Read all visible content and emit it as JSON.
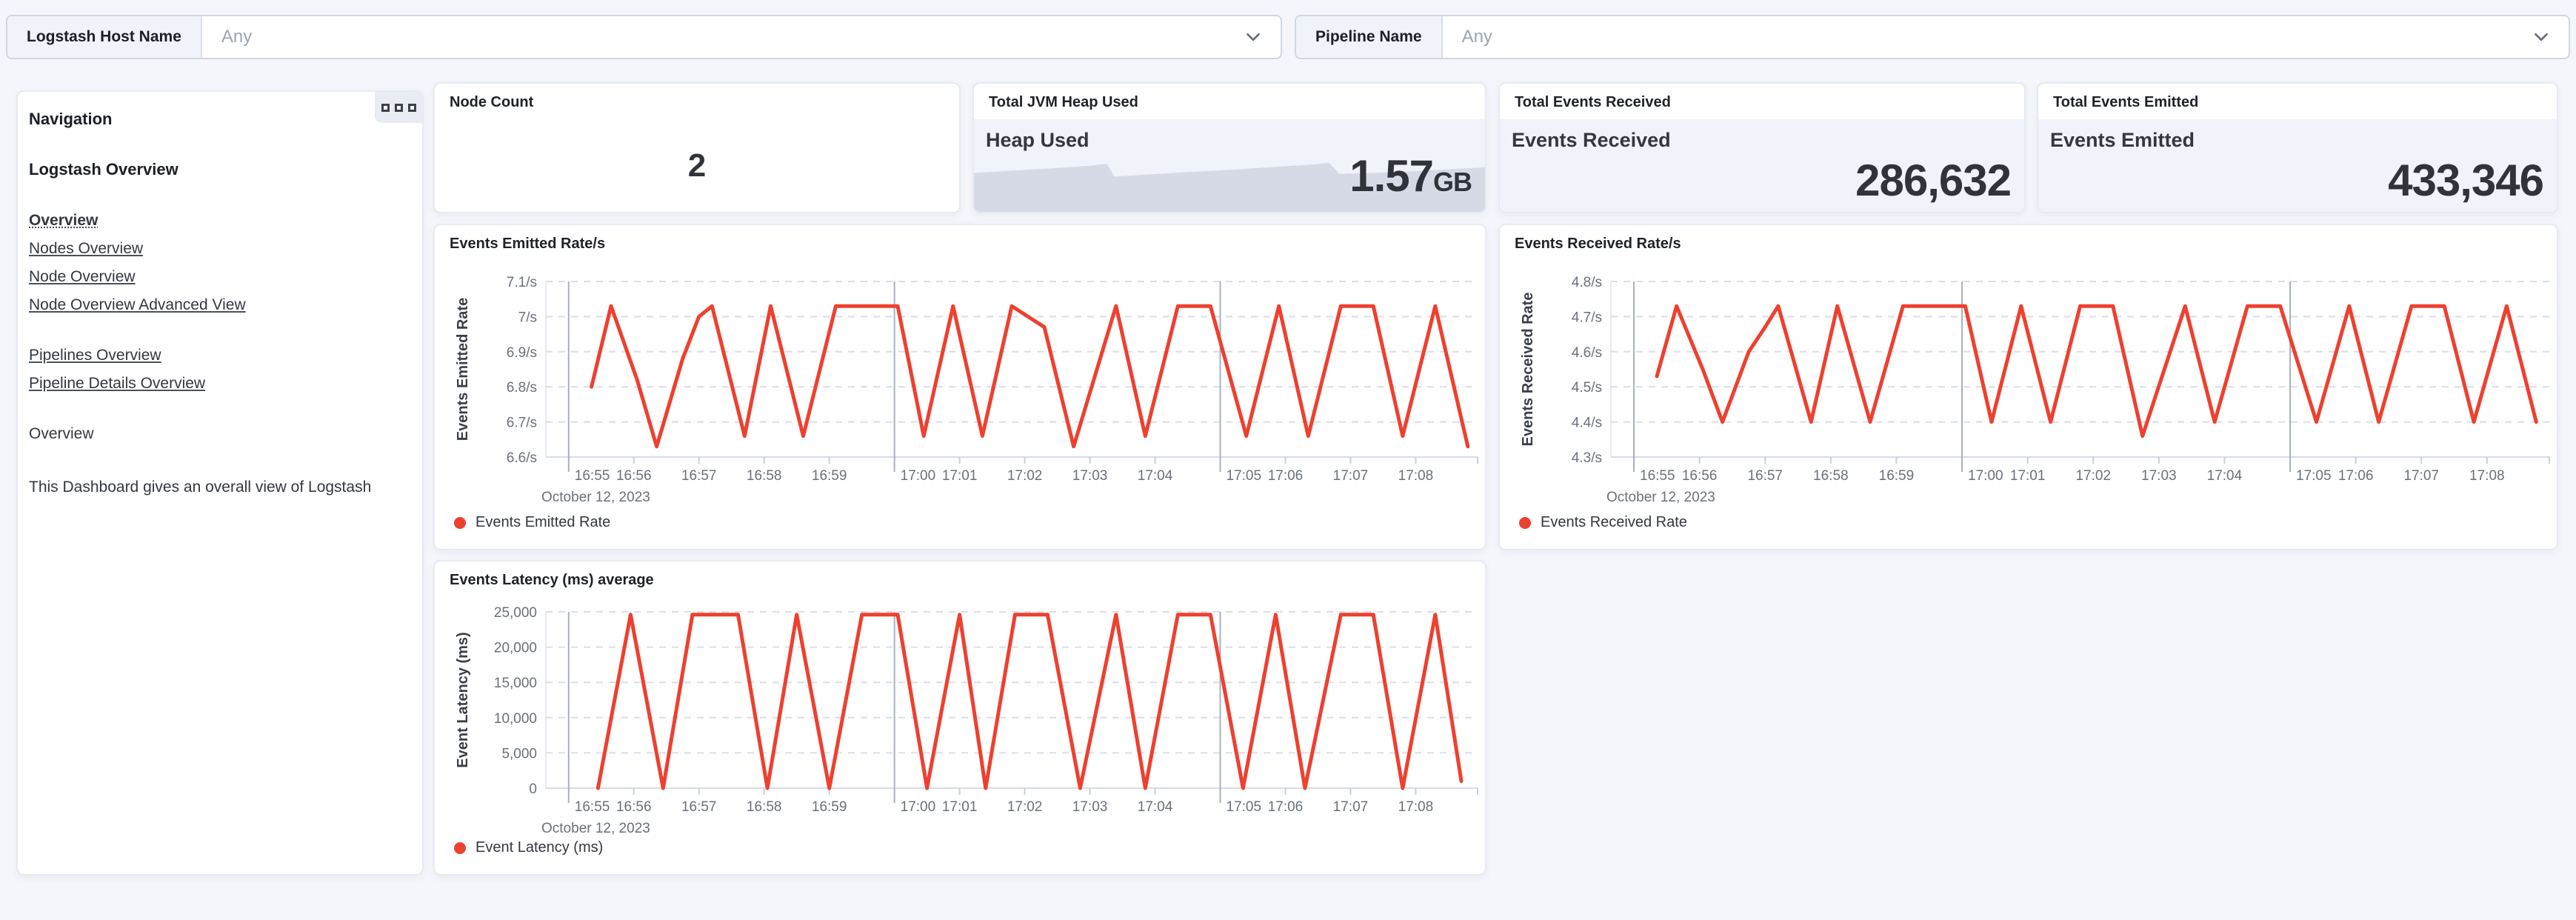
{
  "colors": {
    "page_bg": "#f4f6fb",
    "panel_bg": "#ffffff",
    "panel_border": "#e6eaf2",
    "metric_inner_bg": "#f0f3f9",
    "accent_red": "#ee402f",
    "spark_fill": "#d5dae6",
    "text_dark": "#343741",
    "text_muted": "#69707d",
    "placeholder": "#9aa5b5",
    "grid_minor": "#d9dee9",
    "grid_major": "#a9b0bf"
  },
  "filters": [
    {
      "label": "Logstash Host Name",
      "value": "Any"
    },
    {
      "label": "Pipeline Name",
      "value": "Any"
    }
  ],
  "navigation": {
    "heading": "Navigation",
    "section_title": "Logstash Overview",
    "links": [
      {
        "label": "Overview",
        "active": true
      },
      {
        "label": "Nodes Overview",
        "active": false
      },
      {
        "label": "Node Overview",
        "active": false
      },
      {
        "label": "Node Overview Advanced View",
        "active": false
      },
      {
        "label": "Pipelines Overview",
        "active": false
      },
      {
        "label": "Pipeline Details Overview",
        "active": false
      }
    ],
    "subheading": "Overview",
    "description": "This Dashboard gives an overall view of Logstash",
    "panel_menu_icon": "boxes-horizontal-icon"
  },
  "metrics": {
    "node_count": {
      "title": "Node Count",
      "value": "2"
    },
    "jvm_heap": {
      "title": "Total JVM Heap Used",
      "label": "Heap Used",
      "value": "1.57",
      "unit": "GB"
    },
    "events_received": {
      "title": "Total Events Received",
      "label": "Events Received",
      "value": "286,632"
    },
    "events_emitted": {
      "title": "Total Events Emitted",
      "label": "Events Emitted",
      "value": "433,346"
    }
  },
  "chart_data": [
    {
      "id": "emitted_rate",
      "type": "line",
      "title": "Events Emitted Rate/s",
      "ylabel": "Events Emitted Rate",
      "legend": "Events Emitted Rate",
      "color": "#ee402f",
      "grid": true,
      "legend_position": "bottom-left",
      "date_label": "October 12, 2023",
      "xlim": [
        -0.35,
        13.95
      ],
      "ylim": [
        6.6,
        7.1
      ],
      "yticks": [
        {
          "v": 7.1,
          "label": "7.1/s"
        },
        {
          "v": 7.0,
          "label": "7/s"
        },
        {
          "v": 6.9,
          "label": "6.9/s"
        },
        {
          "v": 6.8,
          "label": "6.8/s"
        },
        {
          "v": 6.7,
          "label": "6.7/s"
        },
        {
          "v": 6.6,
          "label": "6.6/s"
        }
      ],
      "xticks": [
        "16:55",
        "16:56",
        "16:57",
        "16:58",
        "16:59",
        "17:00",
        "17:01",
        "17:02",
        "17:03",
        "17:04",
        "17:05",
        "17:06",
        "17:07",
        "17:08"
      ],
      "x_major_indices": [
        0,
        5,
        10
      ],
      "points": [
        [
          0.35,
          6.8
        ],
        [
          0.65,
          7.03
        ],
        [
          1.05,
          6.82
        ],
        [
          1.35,
          6.63
        ],
        [
          1.75,
          6.88
        ],
        [
          2.0,
          7.0
        ],
        [
          2.2,
          7.03
        ],
        [
          2.7,
          6.66
        ],
        [
          3.1,
          7.03
        ],
        [
          3.6,
          6.66
        ],
        [
          4.1,
          7.03
        ],
        [
          4.5,
          7.03
        ],
        [
          5.05,
          7.03
        ],
        [
          5.45,
          6.66
        ],
        [
          5.9,
          7.03
        ],
        [
          6.35,
          6.66
        ],
        [
          6.8,
          7.03
        ],
        [
          7.3,
          6.97
        ],
        [
          7.75,
          6.63
        ],
        [
          8.4,
          7.03
        ],
        [
          8.85,
          6.66
        ],
        [
          9.35,
          7.03
        ],
        [
          9.85,
          7.03
        ],
        [
          10.4,
          6.66
        ],
        [
          10.9,
          7.03
        ],
        [
          11.35,
          6.66
        ],
        [
          11.85,
          7.03
        ],
        [
          12.35,
          7.03
        ],
        [
          12.8,
          6.66
        ],
        [
          13.3,
          7.03
        ],
        [
          13.8,
          6.63
        ]
      ]
    },
    {
      "id": "received_rate",
      "type": "line",
      "title": "Events Received Rate/s",
      "ylabel": "Events Received Rate",
      "legend": "Events Received Rate",
      "color": "#ee402f",
      "grid": true,
      "legend_position": "bottom-left",
      "date_label": "October 12, 2023",
      "xlim": [
        -0.35,
        13.95
      ],
      "ylim": [
        4.3,
        4.8
      ],
      "yticks": [
        {
          "v": 4.8,
          "label": "4.8/s"
        },
        {
          "v": 4.7,
          "label": "4.7/s"
        },
        {
          "v": 4.6,
          "label": "4.6/s"
        },
        {
          "v": 4.5,
          "label": "4.5/s"
        },
        {
          "v": 4.4,
          "label": "4.4/s"
        },
        {
          "v": 4.3,
          "label": "4.3/s"
        }
      ],
      "xticks": [
        "16:55",
        "16:56",
        "16:57",
        "16:58",
        "16:59",
        "17:00",
        "17:01",
        "17:02",
        "17:03",
        "17:04",
        "17:05",
        "17:06",
        "17:07",
        "17:08"
      ],
      "x_major_indices": [
        0,
        5,
        10
      ],
      "points": [
        [
          0.35,
          4.53
        ],
        [
          0.65,
          4.73
        ],
        [
          1.05,
          4.55
        ],
        [
          1.35,
          4.4
        ],
        [
          1.75,
          4.6
        ],
        [
          2.0,
          4.67
        ],
        [
          2.2,
          4.73
        ],
        [
          2.7,
          4.4
        ],
        [
          3.1,
          4.73
        ],
        [
          3.6,
          4.4
        ],
        [
          4.1,
          4.73
        ],
        [
          4.5,
          4.73
        ],
        [
          5.05,
          4.73
        ],
        [
          5.45,
          4.4
        ],
        [
          5.9,
          4.73
        ],
        [
          6.35,
          4.4
        ],
        [
          6.8,
          4.73
        ],
        [
          7.3,
          4.73
        ],
        [
          7.75,
          4.36
        ],
        [
          8.4,
          4.73
        ],
        [
          8.85,
          4.4
        ],
        [
          9.35,
          4.73
        ],
        [
          9.85,
          4.73
        ],
        [
          10.4,
          4.4
        ],
        [
          10.9,
          4.73
        ],
        [
          11.35,
          4.4
        ],
        [
          11.85,
          4.73
        ],
        [
          12.35,
          4.73
        ],
        [
          12.8,
          4.4
        ],
        [
          13.3,
          4.73
        ],
        [
          13.75,
          4.4
        ]
      ]
    },
    {
      "id": "latency",
      "type": "line",
      "title": "Events Latency (ms) average",
      "ylabel": "Event Latency (ms)",
      "legend": "Event Latency (ms)",
      "color": "#ee402f",
      "grid": true,
      "legend_position": "bottom-left",
      "date_label": "October 12, 2023",
      "xlim": [
        -0.35,
        13.95
      ],
      "ylim": [
        0,
        25000
      ],
      "yticks": [
        {
          "v": 25000,
          "label": "25,000"
        },
        {
          "v": 20000,
          "label": "20,000"
        },
        {
          "v": 15000,
          "label": "15,000"
        },
        {
          "v": 10000,
          "label": "10,000"
        },
        {
          "v": 5000,
          "label": "5,000"
        },
        {
          "v": 0,
          "label": "0"
        }
      ],
      "xticks": [
        "16:55",
        "16:56",
        "16:57",
        "16:58",
        "16:59",
        "17:00",
        "17:01",
        "17:02",
        "17:03",
        "17:04",
        "17:05",
        "17:06",
        "17:07",
        "17:08"
      ],
      "x_major_indices": [
        0,
        5,
        10
      ],
      "points": [
        [
          0.45,
          0
        ],
        [
          0.95,
          24600
        ],
        [
          1.45,
          0
        ],
        [
          1.9,
          24600
        ],
        [
          2.6,
          24600
        ],
        [
          3.05,
          0
        ],
        [
          3.5,
          24600
        ],
        [
          4.0,
          0
        ],
        [
          4.5,
          24600
        ],
        [
          5.05,
          24600
        ],
        [
          5.5,
          0
        ],
        [
          6.0,
          24600
        ],
        [
          6.4,
          0
        ],
        [
          6.85,
          24600
        ],
        [
          7.35,
          24600
        ],
        [
          7.85,
          0
        ],
        [
          8.4,
          24600
        ],
        [
          8.85,
          0
        ],
        [
          9.35,
          24600
        ],
        [
          9.85,
          24600
        ],
        [
          10.35,
          0
        ],
        [
          10.85,
          24600
        ],
        [
          11.3,
          0
        ],
        [
          11.85,
          24600
        ],
        [
          12.35,
          24600
        ],
        [
          12.8,
          0
        ],
        [
          13.3,
          24600
        ],
        [
          13.7,
          1000
        ]
      ]
    },
    {
      "id": "jvm_heap_spark",
      "type": "area",
      "title": "Heap Used sparkline",
      "color": "#d5dae6",
      "note": "normalized heap-used trend inside the Total JVM Heap Used metric, x 0-1, height fraction 0-1",
      "points": [
        [
          0.0,
          0.42
        ],
        [
          0.06,
          0.44
        ],
        [
          0.12,
          0.46
        ],
        [
          0.18,
          0.48
        ],
        [
          0.23,
          0.5
        ],
        [
          0.26,
          0.52
        ],
        [
          0.275,
          0.38
        ],
        [
          0.33,
          0.4
        ],
        [
          0.42,
          0.43
        ],
        [
          0.52,
          0.46
        ],
        [
          0.6,
          0.49
        ],
        [
          0.66,
          0.51
        ],
        [
          0.695,
          0.53
        ],
        [
          0.715,
          0.41
        ],
        [
          0.78,
          0.42
        ],
        [
          0.86,
          0.44
        ],
        [
          0.93,
          0.46
        ],
        [
          1.0,
          0.48
        ]
      ]
    }
  ]
}
